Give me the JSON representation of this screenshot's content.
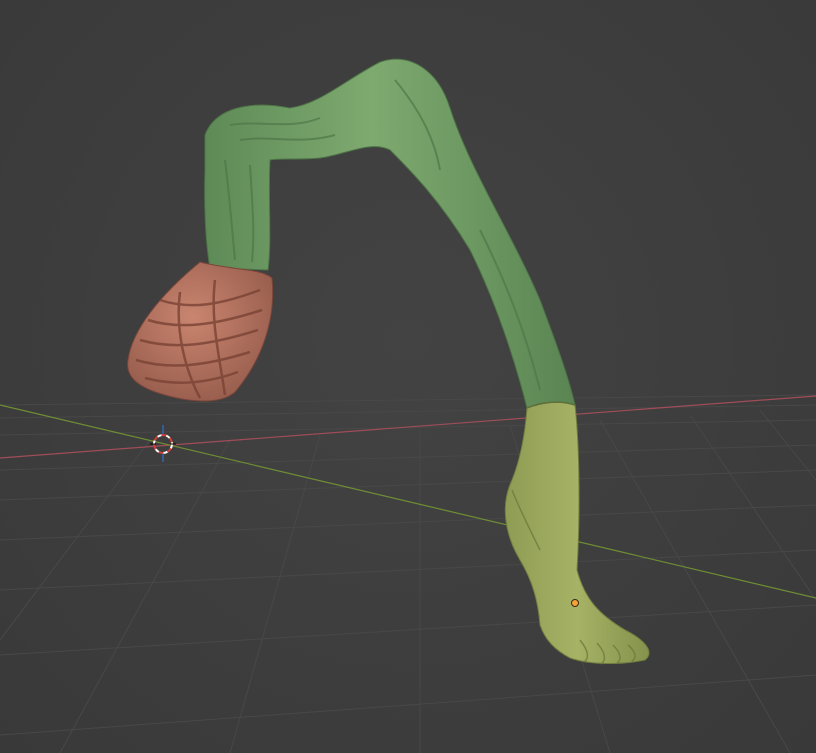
{
  "viewport": {
    "background": "#3d3d3d",
    "grid_color": "#4a4a4a",
    "x_axis_color": "#b35460",
    "y_axis_color": "#7a9a3a"
  },
  "model": {
    "icon": "sculpted-leg-icon",
    "thigh_color": "#6f9a63",
    "foot_color": "#98a85a",
    "hip_flesh_color": "#b8735e"
  },
  "cursor_3d": {
    "icon": "3d-cursor-icon",
    "color": "#ffffff"
  },
  "origin_point": {
    "icon": "origin-dot-icon",
    "color": "#f5a23a"
  }
}
